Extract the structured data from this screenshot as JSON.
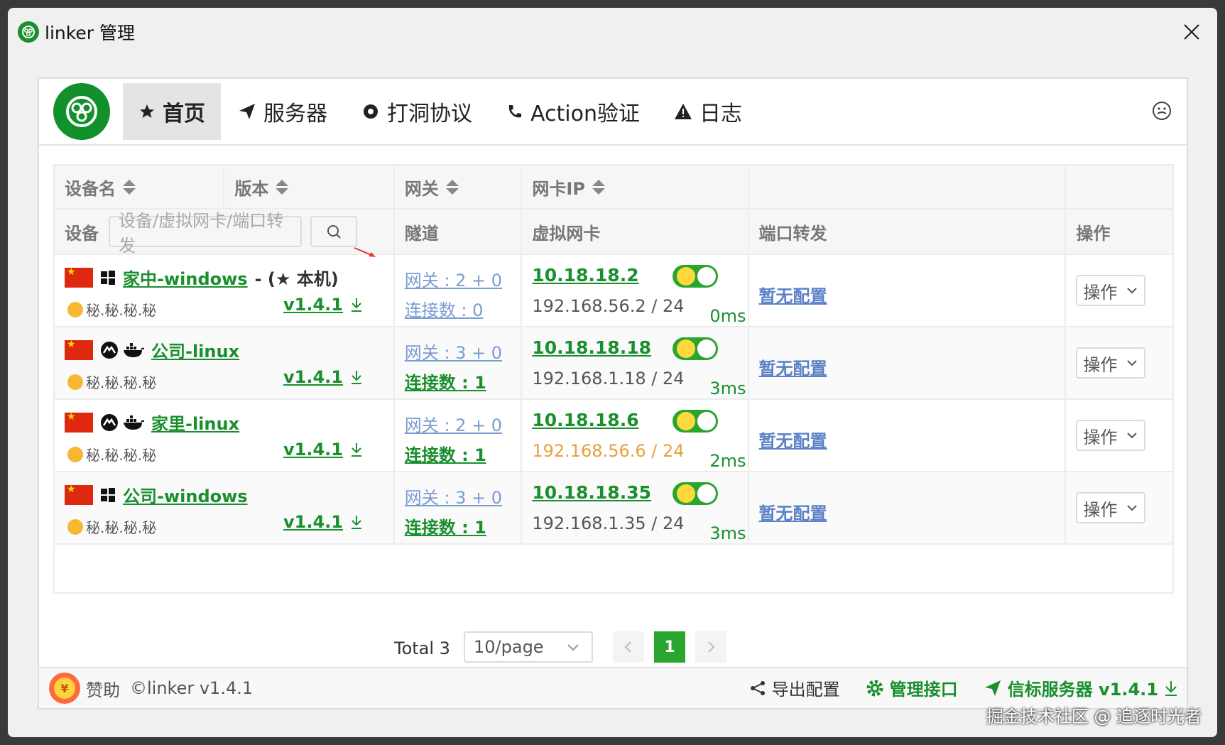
{
  "window": {
    "title": "linker 管理"
  },
  "nav": {
    "items": [
      {
        "label": "首页",
        "icon": "star-icon"
      },
      {
        "label": "服务器",
        "icon": "send-icon"
      },
      {
        "label": "打洞协议",
        "icon": "gear-icon"
      },
      {
        "label": "Action验证",
        "icon": "phone-icon"
      },
      {
        "label": "日志",
        "icon": "warning-icon"
      }
    ]
  },
  "table": {
    "headers": {
      "device_name": "设备名",
      "version": "版本",
      "gateway": "网关",
      "nic_ip": "网卡IP",
      "device": "设备",
      "tunnel": "隧道",
      "virtual_nic": "虚拟网卡",
      "port_forward": "端口转发",
      "operation": "操作"
    },
    "search": {
      "placeholder": "设备/虚拟网卡/端口转发"
    },
    "rows": [
      {
        "name": "家中-windows",
        "local_suffix": "- (★ 本机)",
        "masked_ip": "秘.秘.秘.秘",
        "version": "v1.4.1",
        "gateway": "网关 : 2 + 0",
        "connections": "连接数 : 0",
        "virtual_ip": "10.18.18.2",
        "lan_ip": "192.168.56.2 / 24",
        "latency": "0ms",
        "port_forward": "暂无配置",
        "op": "操作",
        "os": "windows",
        "connected": false,
        "lan_warn": false
      },
      {
        "name": "公司-linux",
        "local_suffix": "",
        "masked_ip": "秘.秘.秘.秘",
        "version": "v1.4.1",
        "gateway": "网关 : 3 + 0",
        "connections": "连接数 : 1",
        "virtual_ip": "10.18.18.18",
        "lan_ip": "192.168.1.18 / 24",
        "latency": "3ms",
        "port_forward": "暂无配置",
        "op": "操作",
        "os": "linux",
        "connected": true,
        "lan_warn": false
      },
      {
        "name": "家里-linux",
        "local_suffix": "",
        "masked_ip": "秘.秘.秘.秘",
        "version": "v1.4.1",
        "gateway": "网关 : 2 + 0",
        "connections": "连接数 : 1",
        "virtual_ip": "10.18.18.6",
        "lan_ip": "192.168.56.6 / 24",
        "latency": "2ms",
        "port_forward": "暂无配置",
        "op": "操作",
        "os": "linux",
        "connected": true,
        "lan_warn": true
      },
      {
        "name": "公司-windows",
        "local_suffix": "",
        "masked_ip": "秘.秘.秘.秘",
        "version": "v1.4.1",
        "gateway": "网关 : 3 + 0",
        "connections": "连接数 : 1",
        "virtual_ip": "10.18.18.35",
        "lan_ip": "192.168.1.35 / 24",
        "latency": "3ms",
        "port_forward": "暂无配置",
        "op": "操作",
        "os": "windows",
        "connected": true,
        "lan_warn": false
      }
    ]
  },
  "pagination": {
    "total": "Total 3",
    "page_size": "10/page",
    "current": "1"
  },
  "footer": {
    "sponsor_label": "赞助",
    "sponsor_symbol": "¥",
    "copyright": "©linker v1.4.1",
    "export": "导出配置",
    "manage_api": "管理接口",
    "beacon": "信标服务器 v1.4.1"
  },
  "watermark": "掘金技术社区 @ 追逐时光者",
  "colors": {
    "brand_green": "#1a8f2e",
    "link_blue": "#7a9ccf",
    "warn_orange": "#e6a23c"
  }
}
